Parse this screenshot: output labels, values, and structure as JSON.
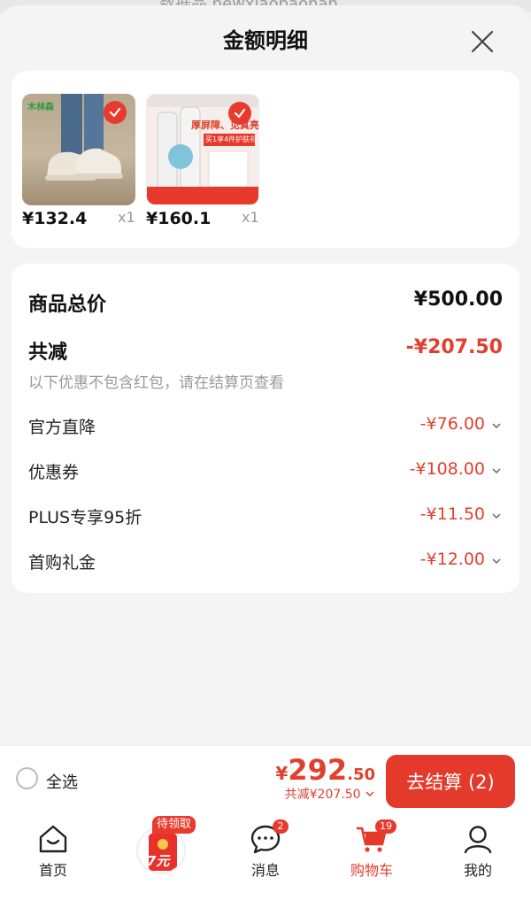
{
  "top_strip_text": "数据品 newxiaobaohan",
  "header": {
    "title": "金额明细"
  },
  "products": [
    {
      "price": "¥132.4",
      "qty": "x1",
      "brand_text": "木林森",
      "selected": true
    },
    {
      "price": "¥160.1",
      "qty": "x1",
      "headline": "厚屏障、见真亮",
      "tag_text": "买1享4件护肤礼",
      "selected": true
    }
  ],
  "summary": {
    "total_label": "商品总价",
    "total_value": "¥500.00",
    "discount_label": "共减",
    "discount_value": "-¥207.50",
    "note": "以下优惠不包含红包，请在结算页查看",
    "items": [
      {
        "label": "官方直降",
        "value": "-¥76.00"
      },
      {
        "label": "优惠券",
        "value": "-¥108.00"
      },
      {
        "label": "PLUS专享95折",
        "value": "-¥11.50"
      },
      {
        "label": "首购礼金",
        "value": "-¥12.00"
      }
    ]
  },
  "checkout": {
    "select_all_label": "全选",
    "currency": "¥",
    "total_int": "292",
    "total_dec": ".50",
    "saved_text": "共减¥207.50",
    "button_label": "去结算 (2)"
  },
  "tabbar": {
    "tabs": [
      {
        "label": "首页"
      },
      {
        "label": ""
      },
      {
        "label": "消息",
        "badge": "2"
      },
      {
        "label": "购物车",
        "badge": "19"
      },
      {
        "label": "我的"
      }
    ],
    "promo": {
      "badge": "待领取",
      "amount": "7元"
    }
  },
  "colors": {
    "accent": "#e43a2b",
    "text": "#111111",
    "muted": "#999999",
    "background": "#f4f4f4"
  }
}
